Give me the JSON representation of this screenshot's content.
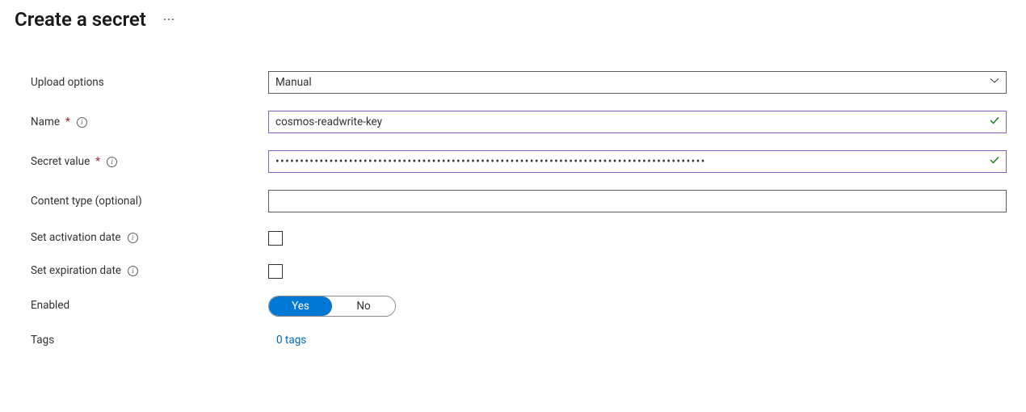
{
  "header": {
    "title": "Create a secret"
  },
  "form": {
    "upload_options": {
      "label": "Upload options",
      "value": "Manual"
    },
    "name": {
      "label": "Name",
      "required": true,
      "value": "cosmos-readwrite-key"
    },
    "secret_value": {
      "label": "Secret value",
      "required": true,
      "value": "••••••••••••••••••••••••••••••••••••••••••••••••••••••••••••••••••••••••••••••••••••••••"
    },
    "content_type": {
      "label": "Content type (optional)",
      "value": ""
    },
    "activation_date": {
      "label": "Set activation date",
      "checked": false
    },
    "expiration_date": {
      "label": "Set expiration date",
      "checked": false
    },
    "enabled": {
      "label": "Enabled",
      "options": {
        "yes": "Yes",
        "no": "No"
      },
      "value": "yes"
    },
    "tags": {
      "label": "Tags",
      "link_text": "0 tags"
    }
  },
  "colors": {
    "accent": "#0078d4",
    "link": "#0067b8",
    "success": "#107c10",
    "validated_border": "#8661c5",
    "required": "#a4262c"
  }
}
